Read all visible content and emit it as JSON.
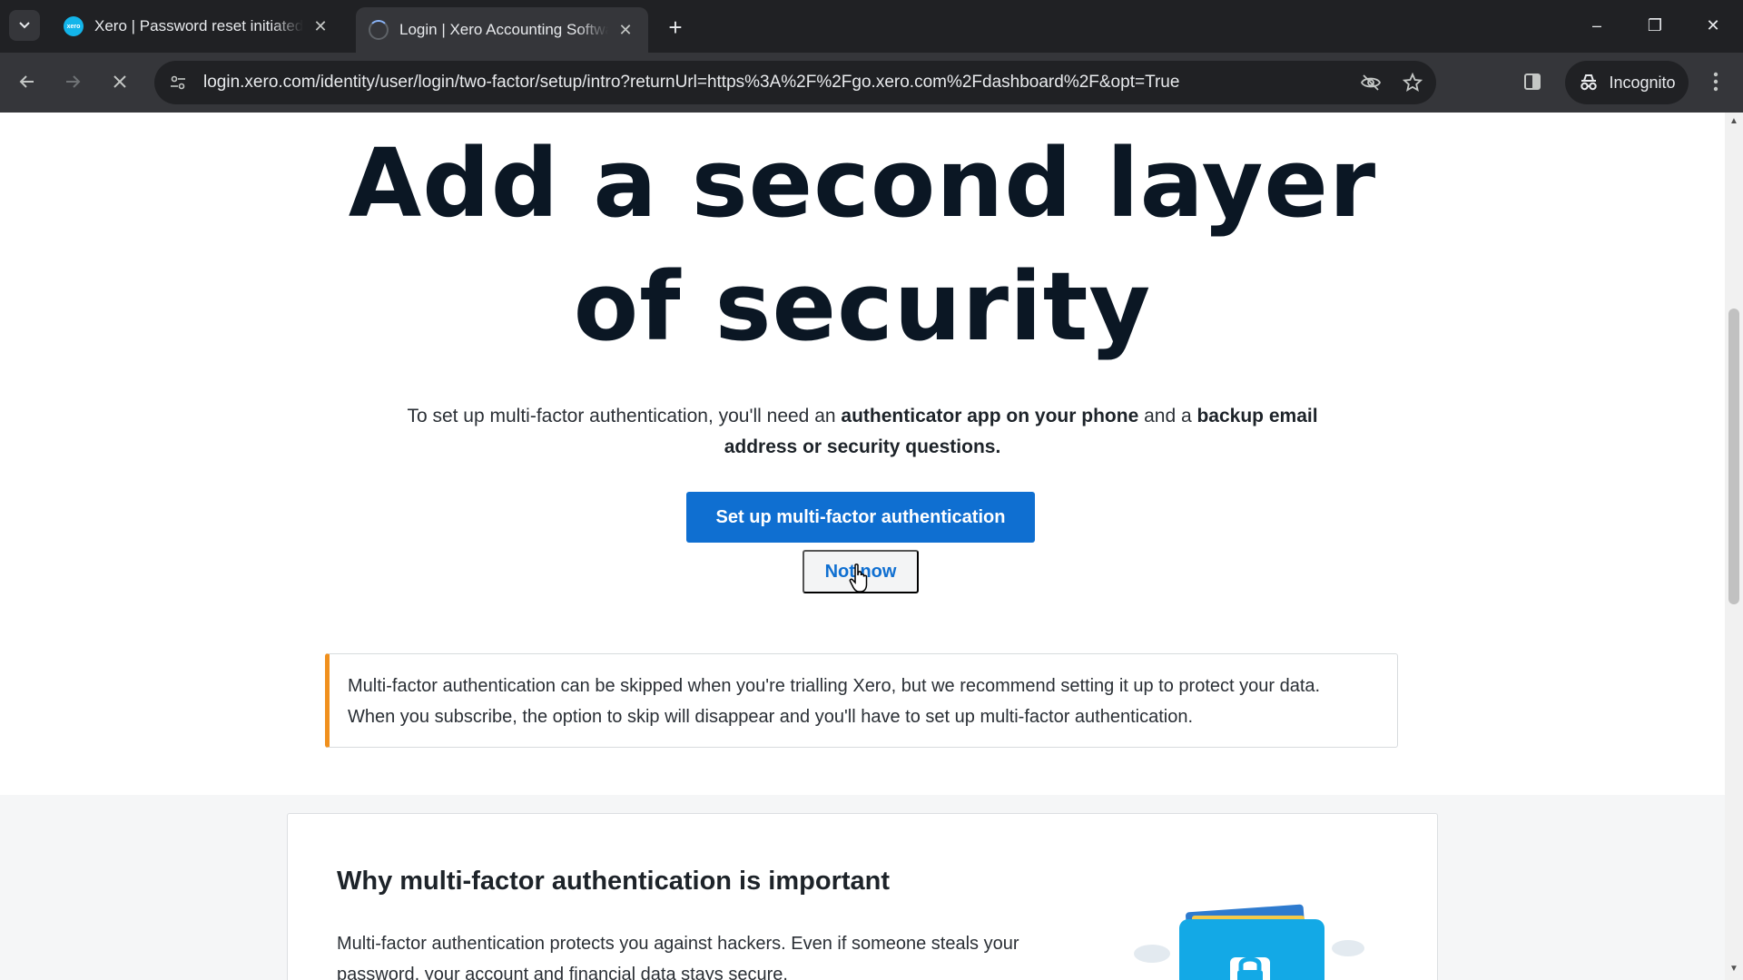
{
  "browser": {
    "tabs": [
      {
        "title": "Xero | Password reset initiated",
        "favicon": "xero"
      },
      {
        "title": "Login | Xero Accounting Software",
        "favicon": "loading"
      }
    ],
    "favicon_text": "xero",
    "new_tab": "+",
    "window_controls": {
      "minimize": "–",
      "restore": "❐",
      "close": "✕"
    },
    "url": "login.xero.com/identity/user/login/two-factor/setup/intro?returnUrl=https%3A%2F%2Fgo.xero.com%2Fdashboard%2F&opt=True",
    "profile_label": "Incognito"
  },
  "page": {
    "title_line1": "Add a second layer",
    "title_line2": "of security",
    "intro": {
      "part1": "To set up multi-factor authentication, you'll need an ",
      "bold1": "authenticator app on your phone",
      "part2": " and a ",
      "bold2": "backup email address or security questions."
    },
    "primary_button": "Set up multi-factor authentication",
    "secondary_button": "Not now",
    "notice_line1": "Multi-factor authentication can be skipped when you're trialling Xero, but we recommend setting it up to protect your data.",
    "notice_line2": "When you subscribe, the option to skip will disappear and you'll have to set up multi-factor authentication.",
    "card": {
      "title": "Why multi-factor authentication is important",
      "body": "Multi-factor authentication protects you against hackers. Even if someone steals your password, your account and financial data stays secure."
    }
  },
  "colors": {
    "primary": "#0f6fd1",
    "warning_accent": "#f0901d",
    "heading": "#0b1724"
  },
  "icons": [
    "tab-search-icon",
    "close-icon",
    "back-arrow-icon",
    "forward-arrow-icon",
    "stop-icon",
    "site-info-icon",
    "eye-off-icon",
    "star-icon",
    "side-panel-icon",
    "incognito-icon",
    "kebab-menu-icon",
    "pointer-cursor-icon",
    "folder-lock-illustration"
  ]
}
